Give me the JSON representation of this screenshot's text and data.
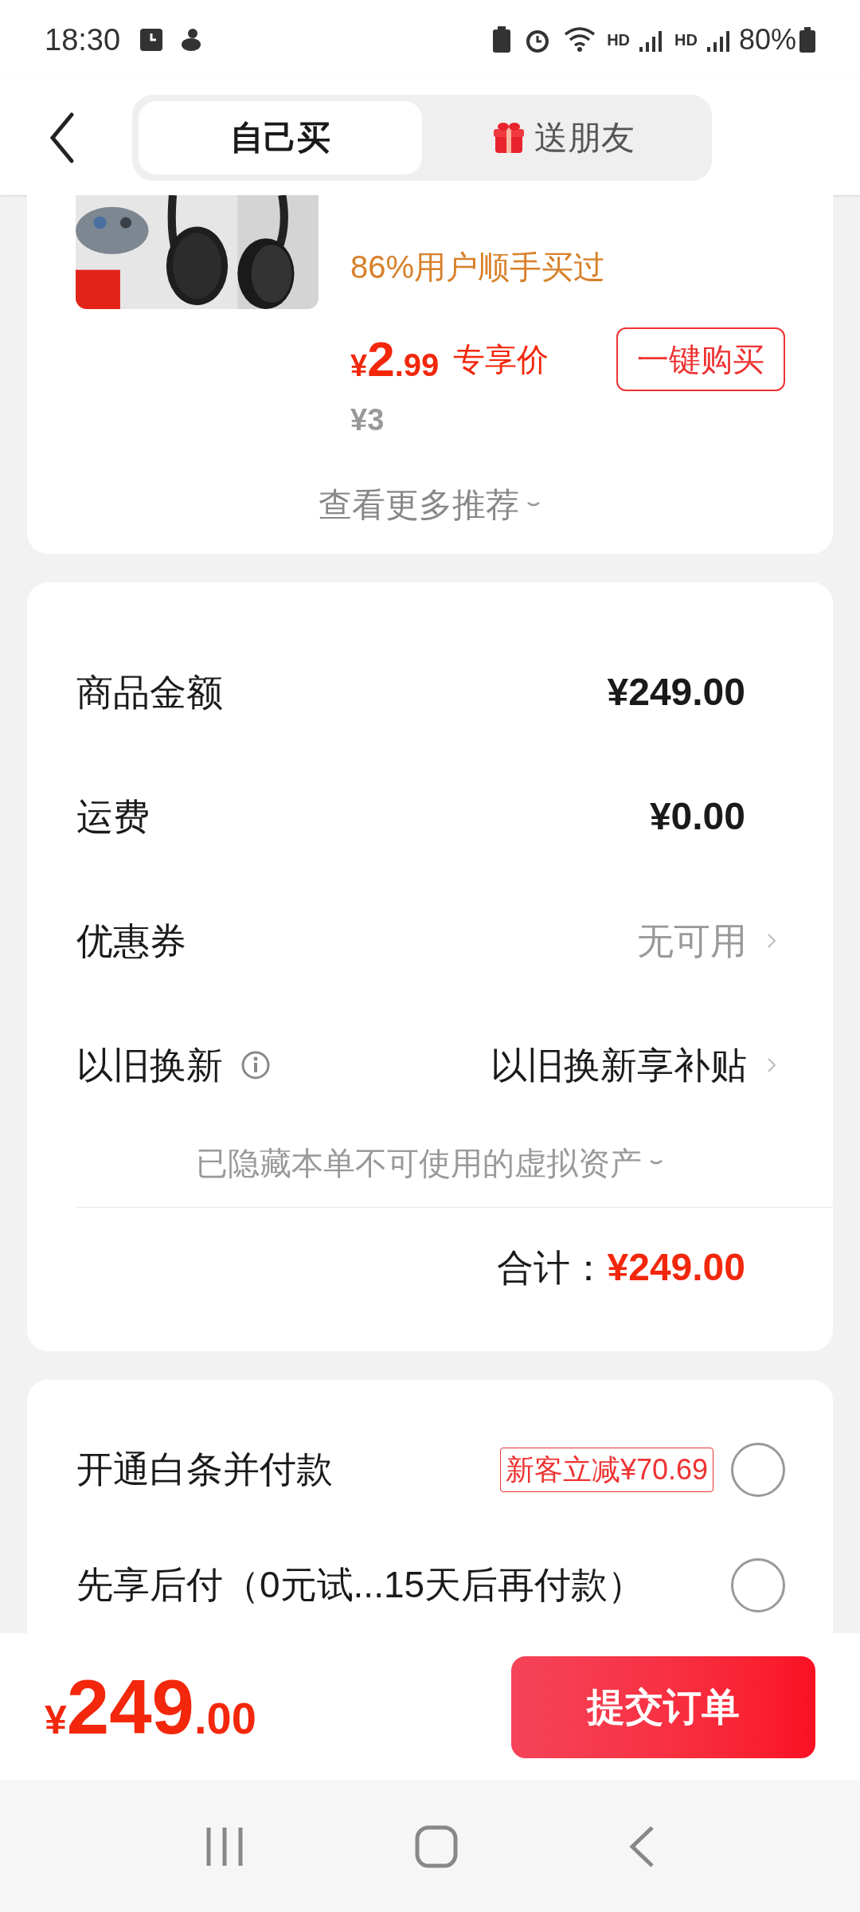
{
  "status_bar": {
    "time": "18:30",
    "battery": "80%",
    "network_labels": [
      "HD",
      "HD"
    ]
  },
  "tabs": [
    {
      "label": "自己买",
      "selected": true,
      "kind": "plain"
    },
    {
      "label": "送朋友",
      "selected": false,
      "kind": "gift"
    }
  ],
  "recommendation": {
    "product": {
      "social_proof": "86%用户顺手买过",
      "price_symbol": "¥",
      "price_integer": "2",
      "price_decimal": ".99",
      "price_label": "专享价",
      "buy_button": "一键购买",
      "original_price": "¥3"
    },
    "more_link": "查看更多推荐"
  },
  "summary": {
    "rows": [
      {
        "kind": "amount",
        "label": "商品金额",
        "value": "¥249.00"
      },
      {
        "kind": "amount",
        "label": "运费",
        "value": "¥0.00"
      },
      {
        "kind": "link",
        "label": "优惠券",
        "value": "无可用",
        "muted": true
      },
      {
        "kind": "link",
        "label": "以旧换新",
        "value": "以旧换新享补贴",
        "info": true,
        "muted": false
      }
    ],
    "hidden_note": "已隐藏本单不可使用的虚拟资产",
    "total_label": "合计：",
    "total_value": "¥249.00"
  },
  "payment_options": [
    {
      "label": "开通白条并付款",
      "badge": "新客立减¥70.69",
      "selected": false
    },
    {
      "label": "先享后付（0元试...15天后再付款）",
      "selected": false
    }
  ],
  "bottom_bar": {
    "price_symbol": "¥",
    "price_integer": "249",
    "price_decimal": ".00",
    "submit_button": "提交订单"
  }
}
